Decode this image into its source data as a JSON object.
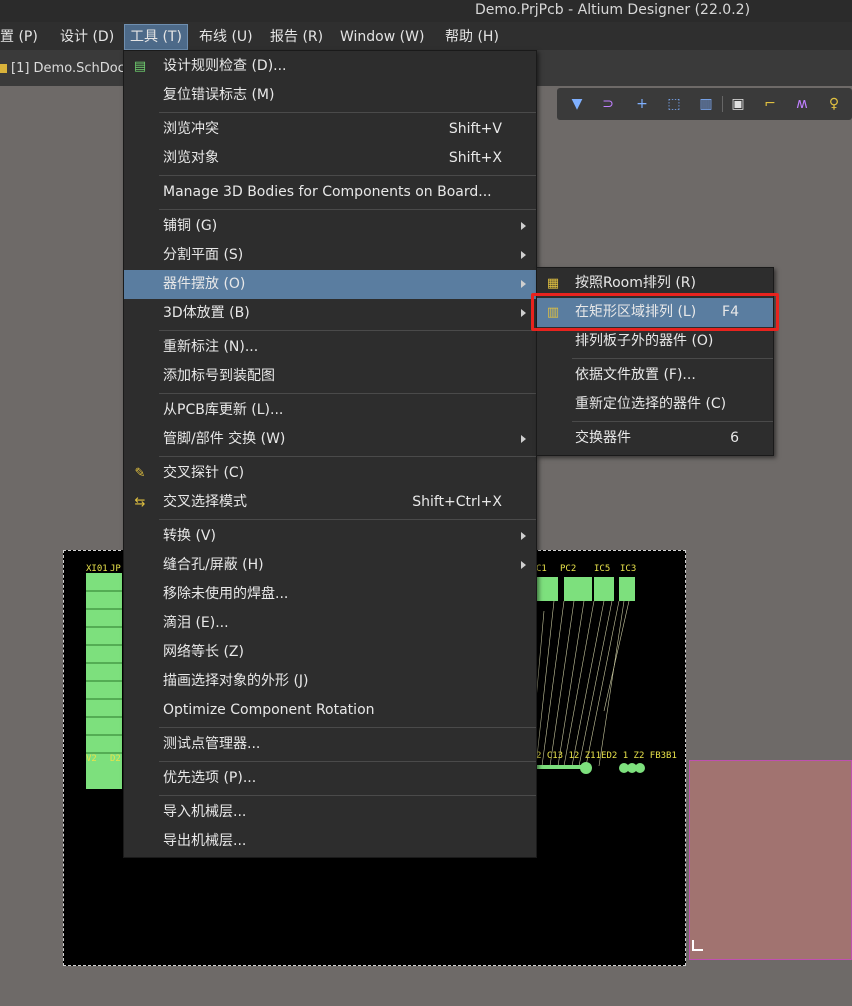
{
  "window": {
    "title": "Demo.PrjPcb - Altium Designer (22.0.2)"
  },
  "menubar": {
    "items": [
      {
        "label": "放置 (P)"
      },
      {
        "label": "设计 (D)"
      },
      {
        "label": "工具 (T)"
      },
      {
        "label": "布线 (U)"
      },
      {
        "label": "报告 (R)"
      },
      {
        "label": "Window (W)"
      },
      {
        "label": "帮助 (H)"
      }
    ]
  },
  "document_tab": {
    "label": "[1] Demo.SchDoc"
  },
  "pcb": {
    "labels": {
      "xi01": "XI01",
      "jp": "JP",
      "c1": "C1",
      "pc2": "PC2",
      "ic5": "IC5",
      "ic3": "IC3",
      "v2": "V2",
      "d2": "D2",
      "row": "2 C13 12 Z11ED2 1 Z2 FB3B1"
    }
  },
  "tools_menu": {
    "items": [
      {
        "label": "设计规则检查 (D)...",
        "shortcut": "",
        "submenu": false,
        "icon": "drc-icon"
      },
      {
        "label": "复位错误标志 (M)",
        "shortcut": "",
        "submenu": false
      },
      {
        "label": "浏览冲突",
        "shortcut": "Shift+V",
        "submenu": false
      },
      {
        "label": "浏览对象",
        "shortcut": "Shift+X",
        "submenu": false
      },
      {
        "label": "Manage 3D Bodies for Components on Board...",
        "shortcut": "",
        "submenu": false
      },
      {
        "label": "铺铜 (G)",
        "shortcut": "",
        "submenu": true
      },
      {
        "label": "分割平面 (S)",
        "shortcut": "",
        "submenu": true
      },
      {
        "label": "器件摆放 (O)",
        "shortcut": "",
        "submenu": true,
        "highlighted": true
      },
      {
        "label": "3D体放置 (B)",
        "shortcut": "",
        "submenu": true
      },
      {
        "label": "重新标注 (N)...",
        "shortcut": "",
        "submenu": false
      },
      {
        "label": "添加标号到装配图",
        "shortcut": "",
        "submenu": false
      },
      {
        "label": "从PCB库更新 (L)...",
        "shortcut": "",
        "submenu": false
      },
      {
        "label": "管脚/部件 交换 (W)",
        "shortcut": "",
        "submenu": true
      },
      {
        "label": "交叉探针 (C)",
        "shortcut": "",
        "submenu": false,
        "icon": "cross-probe-icon"
      },
      {
        "label": "交叉选择模式",
        "shortcut": "Shift+Ctrl+X",
        "submenu": false,
        "icon": "cross-select-icon"
      },
      {
        "label": "转换 (V)",
        "shortcut": "",
        "submenu": true
      },
      {
        "label": "缝合孔/屏蔽 (H)",
        "shortcut": "",
        "submenu": true
      },
      {
        "label": "移除未使用的焊盘...",
        "shortcut": "",
        "submenu": false
      },
      {
        "label": "滴泪 (E)...",
        "shortcut": "",
        "submenu": false
      },
      {
        "label": "网络等长 (Z)",
        "shortcut": "",
        "submenu": false
      },
      {
        "label": "描画选择对象的外形 (J)",
        "shortcut": "",
        "submenu": false
      },
      {
        "label": "Optimize Component Rotation",
        "shortcut": "",
        "submenu": false
      },
      {
        "label": "测试点管理器...",
        "shortcut": "",
        "submenu": false
      },
      {
        "label": "优先选项 (P)...",
        "shortcut": "",
        "submenu": false
      },
      {
        "label": "导入机械层...",
        "shortcut": "",
        "submenu": false
      },
      {
        "label": "导出机械层...",
        "shortcut": "",
        "submenu": false
      }
    ]
  },
  "placement_submenu": {
    "items": [
      {
        "label": "按照Room排列 (R)",
        "shortcut": "",
        "icon": "room-arrange-icon"
      },
      {
        "label": "在矩形区域排列 (L)",
        "shortcut": "F4",
        "icon": "rect-arrange-icon",
        "highlighted": true
      },
      {
        "label": "排列板子外的器件 (O)",
        "shortcut": ""
      },
      {
        "label": "依据文件放置 (F)...",
        "shortcut": ""
      },
      {
        "label": "重新定位选择的器件 (C)",
        "shortcut": ""
      },
      {
        "label": "交换器件",
        "shortcut": "6"
      }
    ]
  },
  "colors": {
    "menu_bg": "#2d2d2d",
    "highlight": "#5a7da0",
    "callout": "#e8231e",
    "pcb_bg": "#000000",
    "pad_green": "#7de07d",
    "label_yellow": "#e8e24a"
  }
}
